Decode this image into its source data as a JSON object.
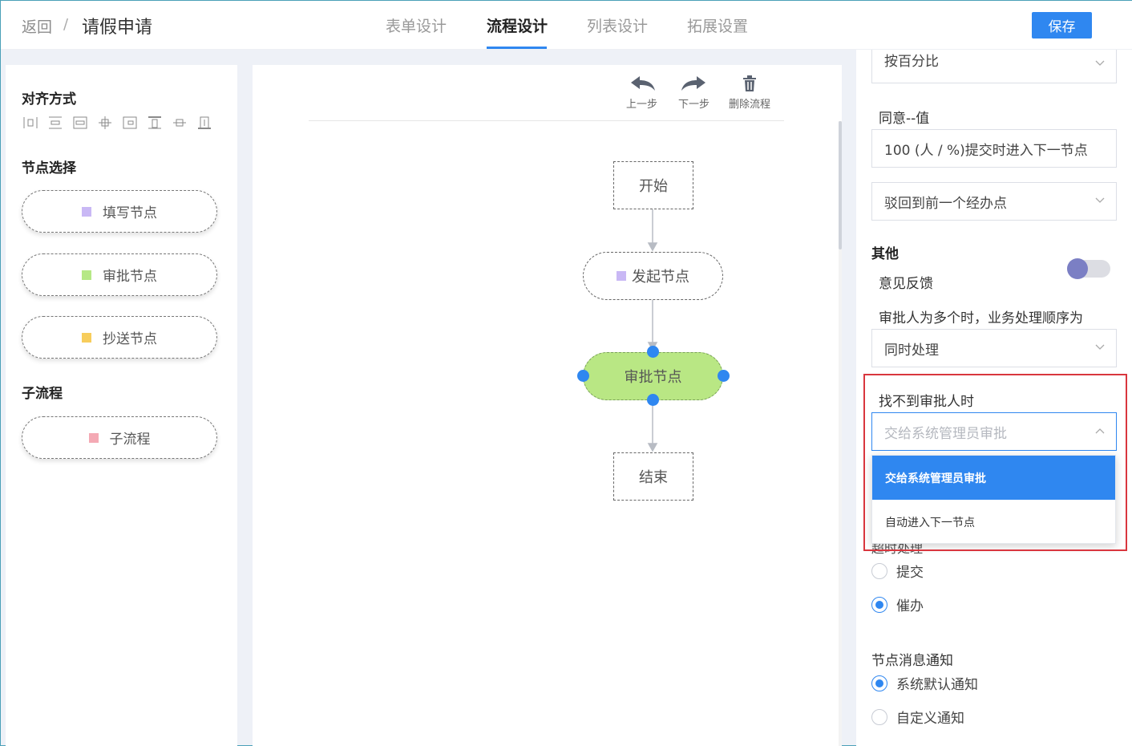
{
  "header": {
    "back_label": "返回",
    "separator": "/",
    "title": "请假申请",
    "tabs": [
      {
        "label": "表单设计"
      },
      {
        "label": "流程设计"
      },
      {
        "label": "列表设计"
      },
      {
        "label": "拓展设置"
      }
    ],
    "save_label": "保存"
  },
  "left_panel": {
    "align_title": "对齐方式",
    "align_icons": [
      "align-left-icon",
      "align-center-horizontal-icon",
      "align-right-icon",
      "distribute-horizontal-icon",
      "align-top-icon",
      "align-middle-icon",
      "align-bottom-icon",
      "distribute-vertical-icon"
    ],
    "node_title": "节点选择",
    "nodes": [
      {
        "label": "填写节点",
        "color": "#c9b8f5"
      },
      {
        "label": "审批节点",
        "color": "#b6e886"
      },
      {
        "label": "抄送节点",
        "color": "#f7cd5c"
      }
    ],
    "subflow_title": "子流程",
    "subflows": [
      {
        "label": "子流程",
        "color": "#f4a9b4"
      }
    ]
  },
  "canvas": {
    "toolbar": {
      "undo_label": "上一步",
      "redo_label": "下一步",
      "delete_label": "删除流程"
    },
    "nodes": {
      "start": "开始",
      "initiate": "发起节点",
      "approve": "审批节点",
      "end": "结束"
    },
    "colors": {
      "initiate_marker": "#c9b8f5",
      "selected_fill": "#b9e784",
      "handle": "#2f87f0"
    }
  },
  "right_panel": {
    "clipped_select_value": "按百分比",
    "agree_label": "同意--值",
    "agree_value": "100 (人 / %)提交时进入下一节点",
    "reject_select": "驳回到前一个经办点",
    "other_title": "其他",
    "feedback_label": "意见反馈",
    "feedback_enabled": true,
    "multi_order_label": "审批人为多个时，业务处理顺序为",
    "multi_order_value": "同时处理",
    "no_approver_label": "找不到审批人时",
    "no_approver_value": "交给系统管理员审批",
    "no_approver_options": [
      {
        "label": "交给系统管理员审批",
        "selected": true
      },
      {
        "label": "自动进入下一节点",
        "selected": false
      }
    ],
    "timeout_label_partial": "超时处理",
    "timeout_options": [
      {
        "label": "提交",
        "checked": false
      },
      {
        "label": "催办",
        "checked": true
      }
    ],
    "notify_title": "节点消息通知",
    "notify_options": [
      {
        "label": "系统默认通知",
        "checked": true
      },
      {
        "label": "自定义通知",
        "checked": false
      }
    ]
  }
}
